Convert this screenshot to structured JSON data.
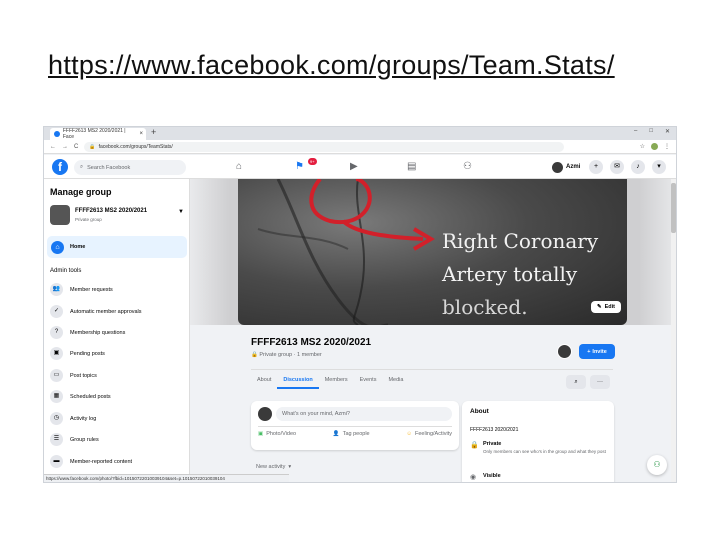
{
  "slide": {
    "title": "https://www.facebook.com/groups/Team.Stats/"
  },
  "browser": {
    "tab_title": "FFFF2613 MS2 2020/2021 | Face",
    "new_tab": "+",
    "tab_close": "×",
    "url": "facebook.com/groups/TeamStats/",
    "status_url": "https://www.facebook.com/photo/?fbid=10150722010039104&set=p.10150722010039104",
    "nav_back": "←",
    "nav_forward": "→",
    "nav_reload": "C",
    "window_min": "–",
    "window_max": "□",
    "window_close": "✕"
  },
  "fb_header": {
    "logo": "f",
    "search_placeholder": "Search Facebook",
    "notification_count": "9+",
    "user_name": "Azmi"
  },
  "sidebar": {
    "title": "Manage group",
    "group_name": "FFFF2613 MS2 2020/2021",
    "group_privacy": "Private group",
    "home_label": "Home",
    "section_label": "Admin tools",
    "items": [
      {
        "label": "Member requests",
        "icon": "members-icon"
      },
      {
        "label": "Automatic member approvals",
        "icon": "auto-approve-icon"
      },
      {
        "label": "Membership questions",
        "icon": "questions-icon"
      },
      {
        "label": "Pending posts",
        "icon": "pending-icon"
      },
      {
        "label": "Post topics",
        "icon": "topics-icon"
      },
      {
        "label": "Scheduled posts",
        "icon": "calendar-icon"
      },
      {
        "label": "Activity log",
        "icon": "clock-icon"
      },
      {
        "label": "Group rules",
        "icon": "rules-icon"
      },
      {
        "label": "Member-reported content",
        "icon": "report-icon"
      }
    ]
  },
  "cover": {
    "text_line1": "Right Coronary",
    "text_line2": "Artery totally",
    "text_line3": "blocked.",
    "edit_label": "Edit"
  },
  "group": {
    "title": "FFFF2613 MS2 2020/2021",
    "meta": "Private group · 1 member",
    "invite_label": "Invite",
    "tabs": [
      "About",
      "Discussion",
      "Members",
      "Events",
      "Media"
    ],
    "more_label": "···"
  },
  "composer": {
    "prompt": "What's on your mind, Azmi?",
    "photo_video": "Photo/Video",
    "tag_people": "Tag people",
    "feeling": "Feeling/Activity"
  },
  "feed": {
    "sort_label": "New activity"
  },
  "about": {
    "heading": "About",
    "description": "FFFF2613 2020/2021",
    "private_title": "Private",
    "private_desc": "Only members can see who's in the group and what they post",
    "visible_title": "Visible"
  },
  "colors": {
    "fb_blue": "#1877f2",
    "background": "#f0f2f5"
  }
}
